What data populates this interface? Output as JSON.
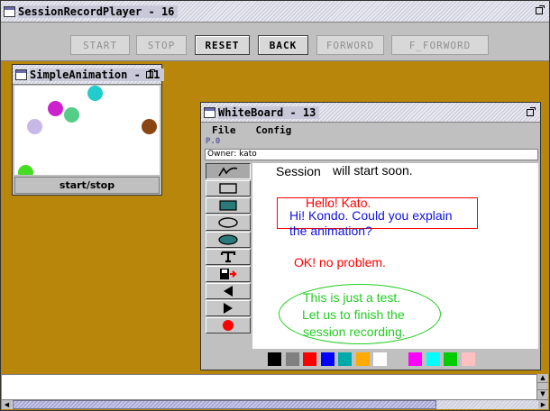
{
  "main_window": {
    "title": "SessionRecordPlayer - 16"
  },
  "toolbar": {
    "buttons": [
      {
        "label": "START",
        "enabled": false
      },
      {
        "label": "STOP",
        "enabled": false
      },
      {
        "label": "RESET",
        "enabled": true
      },
      {
        "label": "BACK",
        "enabled": true
      },
      {
        "label": "FORWORD",
        "enabled": false
      },
      {
        "label": "F_FORWORD",
        "enabled": false
      }
    ]
  },
  "animation_window": {
    "title": "SimpleAnimation - 11",
    "start_stop_label": "start/stop",
    "balls": [
      {
        "color": "#22cccc"
      },
      {
        "color": "#cc22cc"
      },
      {
        "color": "#55cc88"
      },
      {
        "color": "#c8b8e8"
      },
      {
        "color": "#8b4513"
      },
      {
        "color": "#44dd22"
      }
    ]
  },
  "whiteboard_window": {
    "title": "WhiteBoard - 13",
    "menus": [
      "File",
      "Config"
    ],
    "page_label": "P.0",
    "owner_text": "Owner: kato",
    "tools": [
      {
        "name": "pen-tool",
        "selected": true
      },
      {
        "name": "rectangle-tool"
      },
      {
        "name": "filled-rectangle-tool"
      },
      {
        "name": "ellipse-tool"
      },
      {
        "name": "filled-ellipse-tool"
      },
      {
        "name": "text-tool"
      },
      {
        "name": "save-tool"
      },
      {
        "name": "back-tool"
      },
      {
        "name": "forward-tool"
      },
      {
        "name": "record-tool"
      }
    ],
    "board": {
      "line_session": "Session",
      "line_start": "will start soon.",
      "hello": "Hello! Kato.",
      "kondo_1": "Hi! Kondo. Could you explain",
      "kondo_2": "the animation?",
      "ok": "OK! no problem.",
      "test_1": "This is just a test.",
      "test_2": "Let us to finish the",
      "test_3": "session recording."
    },
    "palette": [
      "#000000",
      "#808080",
      "#ff0000",
      "#0000ff",
      "#00aaaa",
      "#ffaa00",
      "#ffffff",
      "#c0c0c0",
      "#ff00ff",
      "#00ffff",
      "#00cc00",
      "#ffc0c0"
    ],
    "colors": {
      "red": "#ff0000",
      "blue": "#1010dd",
      "green": "#22cc22"
    }
  }
}
